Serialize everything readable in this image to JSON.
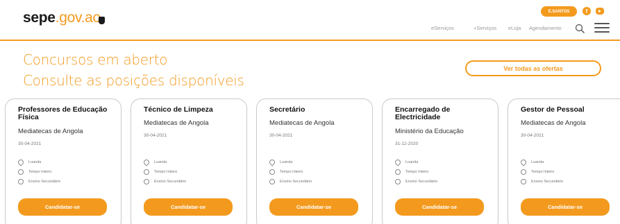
{
  "header": {
    "logo_main": "sepe",
    "logo_dot": ".",
    "logo_domain": "gov.ao",
    "user_label": "E.SANTOS",
    "nav": [
      "eServiços",
      "+Serviços",
      "eLoja",
      "Agendamento"
    ]
  },
  "hero": {
    "line1": "Concursos em aberto",
    "line2": "Consulte  as posições disponíveis",
    "offers_button": "Ver todas as ofertas"
  },
  "cards": [
    {
      "title": "Professores de Educação Física",
      "org": "Mediatecas de Angola",
      "date": "30-04-2021",
      "location": "Luanda",
      "schedule": "Tempo Inteiro",
      "education": "Ensino Secundário",
      "apply": "Candidatar-se"
    },
    {
      "title": "Técnico de Limpeza",
      "org": "Mediatecas de Angola",
      "date": "30-04-2021",
      "location": "Luanda",
      "schedule": "Tempo Inteiro",
      "education": "Ensino Secundário",
      "apply": "Candidatar-se"
    },
    {
      "title": "Secretário",
      "org": "Mediatecas de Angola",
      "date": "30-04-2021",
      "location": "Luanda",
      "schedule": "Tempo Inteiro",
      "education": "Ensino Secundário",
      "apply": "Candidatar-se"
    },
    {
      "title": "Encarregado de Electricidade",
      "org": "Ministério da Educação",
      "date": "31-12-2020",
      "location": "Luanda",
      "schedule": "Tempo Inteiro",
      "education": "Ensino Secundário",
      "apply": "Candidatar-se"
    },
    {
      "title": "Gestor de Pessoal",
      "org": "Mediatecas de Angola",
      "date": "30-04-2021",
      "location": "Luanda",
      "schedule": "Tempo Inteiro",
      "education": "Ensino Secundário",
      "apply": "Candidatar-se"
    }
  ],
  "colors": {
    "accent": "#f39a1e"
  },
  "icons": [
    "facebook-icon",
    "youtube-icon",
    "search-icon",
    "menu-icon",
    "location-pin-icon",
    "clock-icon",
    "education-icon",
    "cursor-hand-icon"
  ]
}
